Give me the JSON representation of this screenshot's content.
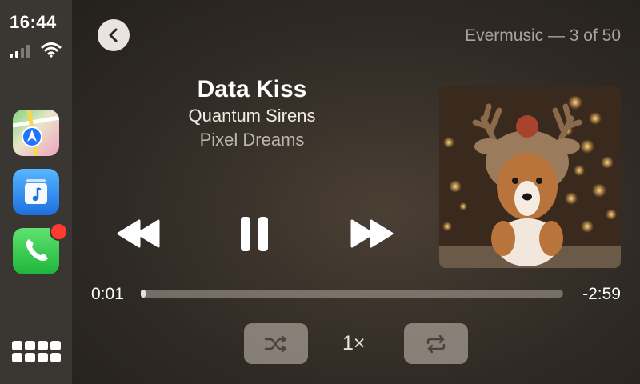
{
  "status": {
    "time": "16:44",
    "signal_icon": "cellular-signal-icon",
    "wifi_icon": "wifi-icon"
  },
  "sidebar": {
    "apps": [
      {
        "name": "Maps",
        "icon": "maps-app-icon"
      },
      {
        "name": "Music",
        "icon": "music-app-icon"
      },
      {
        "name": "Phone",
        "icon": "phone-app-icon",
        "badge": true
      }
    ],
    "launcher_icon": "app-grid-icon"
  },
  "header": {
    "source": "Evermusic — 3 of 50"
  },
  "track": {
    "title": "Data Kiss",
    "artist": "Quantum Sirens",
    "album": "Pixel Dreams"
  },
  "playback": {
    "elapsed": "0:01",
    "remaining": "-2:59",
    "progress": 0.006,
    "speed": "1×",
    "state": "playing"
  },
  "colors": {
    "notification": "#ff3b30",
    "accent": "#ffffff"
  }
}
